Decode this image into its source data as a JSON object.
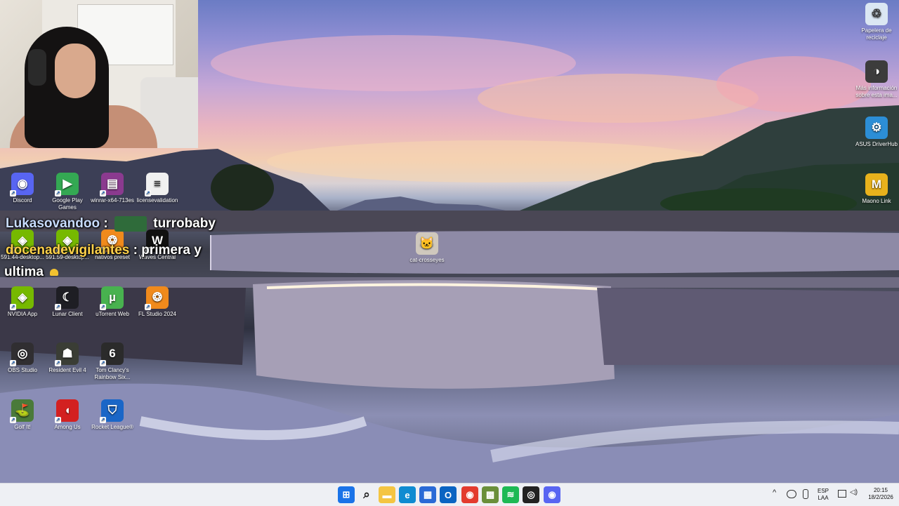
{
  "desktop": {
    "left_icons": [
      {
        "label": "Discord",
        "icon": "discord-icon",
        "color": "#5865f2",
        "glyph": "◉"
      },
      {
        "label": "Google Play Games",
        "icon": "google-play-games-icon",
        "color": "#34a853",
        "glyph": "▶"
      },
      {
        "label": "winrar-x64-713es",
        "icon": "winrar-icon",
        "color": "#8b3a8f",
        "glyph": "▤"
      },
      {
        "label": "licensevalidation",
        "icon": "document-icon",
        "color": "#f0f0f0",
        "glyph": "≡"
      },
      {
        "label": "591.44-desktop...",
        "icon": "nvidia-installer-icon",
        "color": "#76b900",
        "glyph": "◈"
      },
      {
        "label": "591.59-desktop...",
        "icon": "nvidia-installer-icon",
        "color": "#76b900",
        "glyph": "◈"
      },
      {
        "label": "nativos preset",
        "icon": "fl-studio-preset-icon",
        "color": "#f08a1c",
        "glyph": "❂"
      },
      {
        "label": "Waves Central",
        "icon": "waves-icon",
        "color": "#111111",
        "glyph": "W"
      },
      {
        "label": "NVIDIA App",
        "icon": "nvidia-icon",
        "color": "#76b900",
        "glyph": "◈"
      },
      {
        "label": "Lunar Client",
        "icon": "lunar-client-icon",
        "color": "#1e1e24",
        "glyph": "☾"
      },
      {
        "label": "uTorrent Web",
        "icon": "utorrent-icon",
        "color": "#48b24f",
        "glyph": "µ"
      },
      {
        "label": "FL Studio 2024",
        "icon": "fl-studio-icon",
        "color": "#f08a1c",
        "glyph": "❂"
      },
      {
        "label": "OBS Studio",
        "icon": "obs-icon",
        "color": "#302e31",
        "glyph": "◎"
      },
      {
        "label": "Resident Evil 4",
        "icon": "resident-evil-icon",
        "color": "#3a3d35",
        "glyph": "☗"
      },
      {
        "label": "Tom Clancy's Rainbow Six...",
        "icon": "rainbow-six-icon",
        "color": "#2b2b2b",
        "glyph": "6"
      },
      {
        "label": "Golf It!",
        "icon": "golf-it-icon",
        "color": "#4a7a3a",
        "glyph": "⛳"
      },
      {
        "label": "Among Us",
        "icon": "among-us-icon",
        "color": "#d32020",
        "glyph": "◖"
      },
      {
        "label": "Rocket League®",
        "icon": "rocket-league-icon",
        "color": "#1a66c7",
        "glyph": "⛉"
      }
    ],
    "middle_icon": {
      "label": "cat-crosseyes",
      "icon": "cat-image-icon",
      "color": "#cfc8bd",
      "glyph": "🐱"
    },
    "right_icons": [
      {
        "label": "Papelera de reciclaje",
        "icon": "recycle-bin-icon",
        "color": "#dbe7f3",
        "glyph": "♲"
      },
      {
        "label": "Más información sobre esta ima...",
        "icon": "info-camera-icon",
        "color": "#3c3c3c",
        "glyph": "◑"
      },
      {
        "label": "ASUS DriverHub",
        "icon": "asus-driverhub-icon",
        "color": "#2c8ed6",
        "glyph": "⚙"
      },
      {
        "label": "Maono Link",
        "icon": "maono-link-icon",
        "color": "#e8b21c",
        "glyph": "M"
      }
    ]
  },
  "chat": {
    "line1_user": "Lukasovandoo",
    "line1_sep": ":",
    "line1_msg": "turrobaby",
    "line2_user": "docenadevigilantes",
    "line2_msg": ": primera y",
    "line3_msg": "ultima"
  },
  "taskbar": {
    "apps": [
      {
        "name": "start-button",
        "icon": "windows-icon",
        "color": "#1a73e8",
        "glyph": "⊞"
      },
      {
        "name": "search-button",
        "icon": "search-icon",
        "color": "transparent",
        "glyph": "⌕"
      },
      {
        "name": "file-explorer-button",
        "icon": "folder-icon",
        "color": "#f4c542",
        "glyph": "▬"
      },
      {
        "name": "edge-button",
        "icon": "edge-icon",
        "color": "#0f8bd1",
        "glyph": "e"
      },
      {
        "name": "store-button",
        "icon": "store-icon",
        "color": "#2a6ad6",
        "glyph": "▦"
      },
      {
        "name": "outlook-button",
        "icon": "outlook-icon",
        "color": "#0a64c2",
        "glyph": "O"
      },
      {
        "name": "chrome-button",
        "icon": "chrome-icon",
        "color": "#e33b2e",
        "glyph": "◉"
      },
      {
        "name": "minecraft-button",
        "icon": "minecraft-icon",
        "color": "#6a8f3a",
        "glyph": "▩"
      },
      {
        "name": "spotify-button",
        "icon": "spotify-icon",
        "color": "#1db954",
        "glyph": "≋"
      },
      {
        "name": "obs-taskbar-button",
        "icon": "obs-icon",
        "color": "#222222",
        "glyph": "◎"
      },
      {
        "name": "discord-taskbar-button",
        "icon": "discord-icon",
        "color": "#5865f2",
        "glyph": "◉"
      }
    ],
    "tray": {
      "chevron": "^",
      "lang_line1": "ESP",
      "lang_line2": "LAA",
      "time": "20:15",
      "date": "18/2/2026"
    }
  }
}
